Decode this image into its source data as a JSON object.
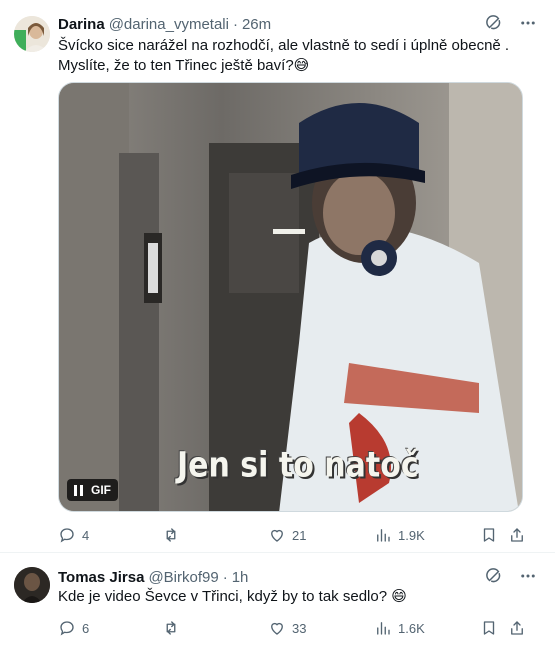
{
  "posts": [
    {
      "author": {
        "name": "Darina",
        "handle": "@darina_vymetali"
      },
      "separator": "·",
      "time": "26m",
      "text": "Švícko sice narážel na rozhodčí, ale vlastně to sedí i úplně obecně . Myslíte, že to ten Třinec ještě baví?😅",
      "media": {
        "caption": "Jen si to natoč",
        "badge": "GIF"
      },
      "stats": {
        "replies": "4",
        "retweets": "",
        "likes": "21",
        "views": "1.9K"
      }
    },
    {
      "author": {
        "name": "Tomas Jirsa",
        "handle": "@Birkof99"
      },
      "separator": "·",
      "time": "1h",
      "text": "Kde je video Ševce v Třinci, když by to tak sedlo? 😄",
      "stats": {
        "replies": "6",
        "retweets": "",
        "likes": "33",
        "views": "1.6K"
      }
    }
  ],
  "icons": [
    "grok-icon",
    "more-icon",
    "reply-icon",
    "retweet-icon",
    "like-icon",
    "views-icon",
    "bookmark-icon",
    "share-icon",
    "pause-icon"
  ],
  "colors": {
    "text": "#0f1419",
    "secondary": "#536471",
    "border": "#eff3f4"
  }
}
